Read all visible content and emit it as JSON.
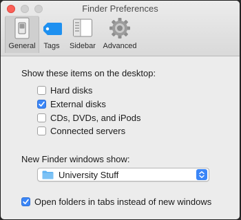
{
  "window": {
    "title": "Finder Preferences"
  },
  "toolbar": {
    "tabs": [
      {
        "id": "general",
        "label": "General",
        "icon": "general-switch-icon",
        "selected": true
      },
      {
        "id": "tags",
        "label": "Tags",
        "icon": "tag-icon",
        "selected": false
      },
      {
        "id": "sidebar",
        "label": "Sidebar",
        "icon": "sidebar-icon",
        "selected": false
      },
      {
        "id": "advanced",
        "label": "Advanced",
        "icon": "gear-icon",
        "selected": false
      }
    ]
  },
  "desktop_section": {
    "heading": "Show these items on the desktop:",
    "items": [
      {
        "label": "Hard disks",
        "checked": false
      },
      {
        "label": "External disks",
        "checked": true
      },
      {
        "label": "CDs, DVDs, and iPods",
        "checked": false
      },
      {
        "label": "Connected servers",
        "checked": false
      }
    ]
  },
  "new_window_section": {
    "heading": "New Finder windows show:",
    "selected_value": "University Stuff",
    "icon": "folder-icon"
  },
  "tabs_option": {
    "label": "Open folders in tabs instead of new windows",
    "checked": true
  },
  "colors": {
    "accent": "#3b86f7",
    "folder": "#61b3f2",
    "tag": "#1e90f0",
    "close_button": "#fc5f57"
  }
}
